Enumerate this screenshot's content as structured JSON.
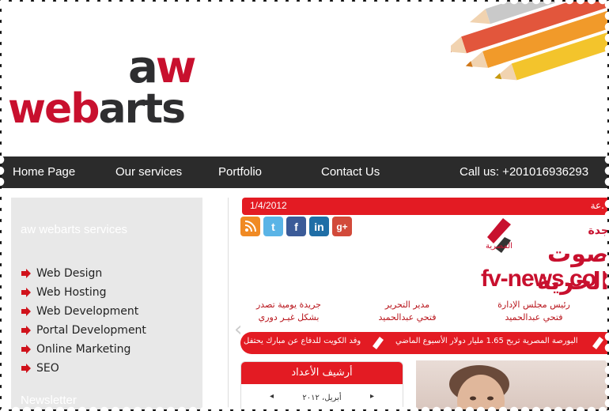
{
  "logo": {
    "mark_a": "a",
    "mark_w": "w",
    "word_web": "web",
    "word_arts": "arts"
  },
  "nav": {
    "items": [
      "Home Page",
      "Our services",
      "Portfolio",
      "Contact Us"
    ],
    "call": "Call us: +201016936293"
  },
  "sidebar": {
    "title": "aw webarts services",
    "services": [
      "Web Design",
      "Web Hosting",
      "Web Development",
      "Portal Development",
      "Online Marketing",
      "SEO"
    ],
    "newsletter": "Newsletter"
  },
  "news": {
    "date": "1/4/2012",
    "bar_trail": "عة.",
    "social": [
      "rss-icon",
      "twitter-icon",
      "facebook-icon",
      "linkedin-icon",
      "googleplus-icon"
    ],
    "logo_top": "جدة",
    "logo_small": "المصرية",
    "logo_big": "صوت الحرية",
    "logo_domain": "fv-news.co",
    "editors": [
      {
        "role": "جريدة يومية تصدر",
        "name": "بشكل غيـر دوري"
      },
      {
        "role": "مدير التحرير",
        "name": "فتحي عبدالحميد"
      },
      {
        "role": "رئيس مجلس الإدارة",
        "name": "فتحي عبدالحميد"
      }
    ],
    "ticker": [
      "البورصة المصرية تربح 1.65 مليار دولار الأسبوع الماضي",
      "وفد الكويت للدفاع عن مبارك يحتفل"
    ],
    "archive_title": "أرشيف الأعداد",
    "archive_month": "أبريل، ٢٠١٢",
    "archive_prev": "◂",
    "archive_next": "▸"
  },
  "colors": {
    "accent_red": "#c8102e",
    "nav_bg": "#2b2b2b",
    "sidebar_bg": "#e8e8e8",
    "news_red": "#e31b23"
  }
}
